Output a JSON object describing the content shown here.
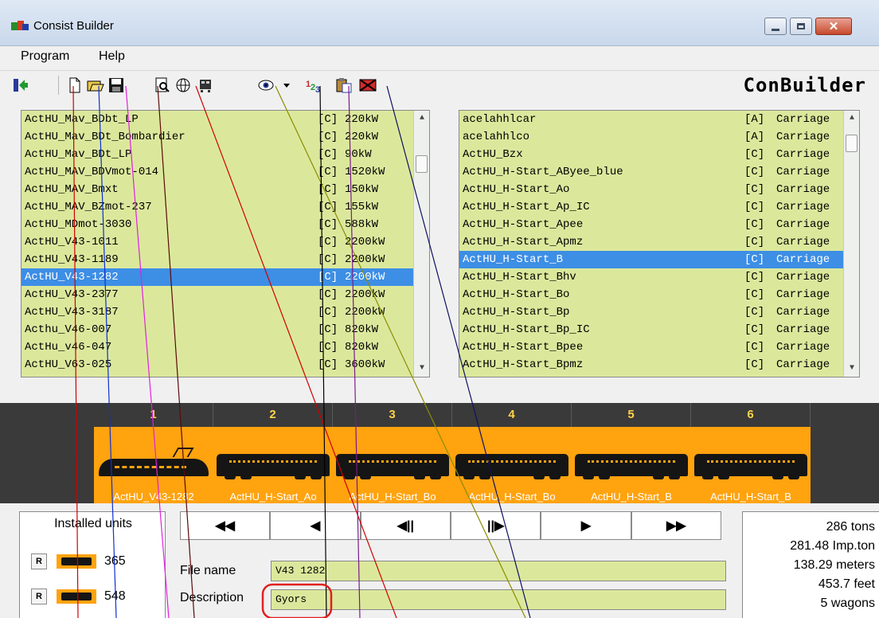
{
  "window": {
    "title": "Consist Builder",
    "close_glyph": "✕"
  },
  "menu": [
    "Program",
    "Help"
  ],
  "toolbar": {
    "logo": "ConBuilder",
    "icons": [
      "exit-icon",
      "new-file-icon",
      "open-folder-icon",
      "save-icon",
      "preview-icon",
      "globe-icon",
      "consist-icon",
      "eye-icon",
      "dropdown-arrow-icon",
      "numbering-icon",
      "clipboard-icon",
      "delete-envelope-icon"
    ]
  },
  "engines_list": {
    "rows": [
      {
        "name": "ActHU_Mav_BDbt_LP",
        "tag": "[C]",
        "value": "220kW"
      },
      {
        "name": "ActHU_Mav_BDt_Bombardier",
        "tag": "[C]",
        "value": "220kW"
      },
      {
        "name": "ActHU_Mav_BDt_LP",
        "tag": "[C]",
        "value": "90kW"
      },
      {
        "name": "ActHU_MAV_BDVmot-014",
        "tag": "[C]",
        "value": "1520kW"
      },
      {
        "name": "ActHU_MAV_Bmxt",
        "tag": "[C]",
        "value": "150kW"
      },
      {
        "name": "ActHU_MAV_BZmot-237",
        "tag": "[C]",
        "value": "155kW"
      },
      {
        "name": "ActHU_MDmot-3030",
        "tag": "[C]",
        "value": "588kW"
      },
      {
        "name": "ActHU_V43-1011",
        "tag": "[C]",
        "value": "2200kW"
      },
      {
        "name": "ActHU_V43-1189",
        "tag": "[C]",
        "value": "2200kW"
      },
      {
        "name": "ActHU_V43-1282",
        "tag": "[C]",
        "value": "2200kW"
      },
      {
        "name": "ActHU_V43-2377",
        "tag": "[C]",
        "value": "2200kW"
      },
      {
        "name": "ActHU_V43-3187",
        "tag": "[C]",
        "value": "2200kW"
      },
      {
        "name": "Acthu_V46-007",
        "tag": "[C]",
        "value": "820kW"
      },
      {
        "name": "ActHu_v46-047",
        "tag": "[C]",
        "value": "820kW"
      },
      {
        "name": "ActHU_V63-025",
        "tag": "[C]",
        "value": "3600kW"
      }
    ],
    "selected_index": 9
  },
  "wagons_list": {
    "rows": [
      {
        "name": "acelahhlcar",
        "tag": "[A]",
        "value": "Carriage"
      },
      {
        "name": "acelahhlco",
        "tag": "[A]",
        "value": "Carriage"
      },
      {
        "name": "ActHU_Bzx",
        "tag": "[C]",
        "value": "Carriage"
      },
      {
        "name": "ActHU_H-Start_AByee_blue",
        "tag": "[C]",
        "value": "Carriage"
      },
      {
        "name": "ActHU_H-Start_Ao",
        "tag": "[C]",
        "value": "Carriage"
      },
      {
        "name": "ActHU_H-Start_Ap_IC",
        "tag": "[C]",
        "value": "Carriage"
      },
      {
        "name": "ActHU_H-Start_Apee",
        "tag": "[C]",
        "value": "Carriage"
      },
      {
        "name": "ActHU_H-Start_Apmz",
        "tag": "[C]",
        "value": "Carriage"
      },
      {
        "name": "ActHU_H-Start_B",
        "tag": "[C]",
        "value": "Carriage"
      },
      {
        "name": "ActHU_H-Start_Bhv",
        "tag": "[C]",
        "value": "Carriage"
      },
      {
        "name": "ActHU_H-Start_Bo",
        "tag": "[C]",
        "value": "Carriage"
      },
      {
        "name": "ActHU_H-Start_Bp",
        "tag": "[C]",
        "value": "Carriage"
      },
      {
        "name": "ActHU_H-Start_Bp_IC",
        "tag": "[C]",
        "value": "Carriage"
      },
      {
        "name": "ActHU_H-Start_Bpee",
        "tag": "[C]",
        "value": "Carriage"
      },
      {
        "name": "ActHU_H-Start_Bpmz",
        "tag": "[C]",
        "value": "Carriage"
      }
    ],
    "selected_index": 8
  },
  "consist": {
    "slots": [
      {
        "number": "1",
        "label": "ActHU_V43-1282",
        "kind": "loco"
      },
      {
        "number": "2",
        "label": "ActHU_H-Start_Ao",
        "kind": "car"
      },
      {
        "number": "3",
        "label": "ActHU_H-Start_Bo",
        "kind": "car"
      },
      {
        "number": "4",
        "label": "ActHU_H-Start_Bo",
        "kind": "car"
      },
      {
        "number": "5",
        "label": "ActHU_H-Start_B",
        "kind": "car"
      },
      {
        "number": "6",
        "label": "ActHU_H-Start_B",
        "kind": "car"
      }
    ]
  },
  "installed_units": {
    "header": "Installed units",
    "reset_label": "R",
    "engines_count": "365",
    "wagons_count": "548"
  },
  "nav_buttons": [
    "◀◀",
    "◀",
    "◀||",
    "||▶",
    "▶",
    "▶▶"
  ],
  "file": {
    "file_name_label": "File name",
    "file_name_value": "V43 1282",
    "description_label": "Description",
    "description_value": "Gyors"
  },
  "stats": {
    "tons": "286 tons",
    "imp_ton": "281.48 Imp.ton",
    "meters": "138.29 meters",
    "feet": "453.7 feet",
    "wagons": "5 wagons"
  },
  "colors": {
    "list_bg": "#dbe89c",
    "selection": "#3d8ee5",
    "consist_orange": "#ffa30f",
    "strip_bg": "#3a3a3a"
  }
}
